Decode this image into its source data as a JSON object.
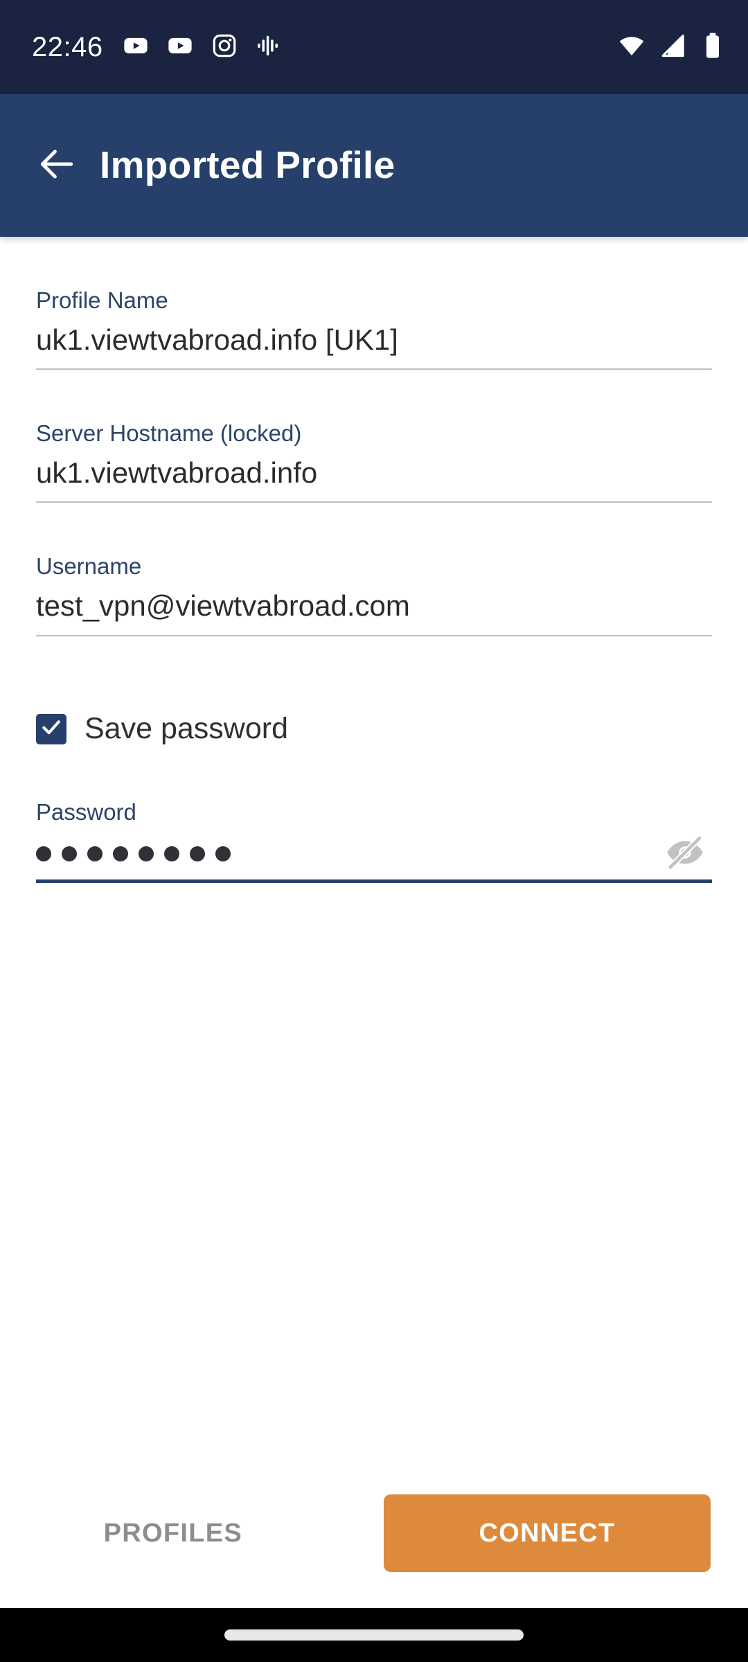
{
  "status_bar": {
    "clock": "22:46",
    "background_color": "#1a2440",
    "left_icons": [
      "youtube-icon",
      "youtube-icon",
      "instagram-icon",
      "google-assistant-icon"
    ],
    "right_icons": [
      "wifi-icon",
      "mobile-signal-off-icon",
      "battery-icon"
    ]
  },
  "app_bar": {
    "title": "Imported Profile",
    "back_icon": "back-arrow-icon",
    "background_color": "#26406b"
  },
  "form": {
    "fields": [
      {
        "label": "Profile Name",
        "value": "uk1.viewtvabroad.info [UK1]",
        "focused": false
      },
      {
        "label": "Server Hostname (locked)",
        "value": "uk1.viewtvabroad.info",
        "focused": false
      },
      {
        "label": "Username",
        "value": "test_vpn@viewtvabroad.com",
        "focused": false
      }
    ],
    "save_password": {
      "label": "Save password",
      "checked": true,
      "check_icon": "checkmark-icon"
    },
    "password": {
      "label": "Password",
      "masked_value": "••••••••",
      "character_count": 8,
      "focused": true,
      "visibility_icon": "eye-off-icon",
      "visibility_state": "hidden"
    }
  },
  "bottom_bar": {
    "profiles_label": "PROFILES",
    "connect_label": "CONNECT",
    "connect_color": "#dd8a3c"
  },
  "nav_bar": {
    "gesture_handle": "home-gesture-pill"
  }
}
